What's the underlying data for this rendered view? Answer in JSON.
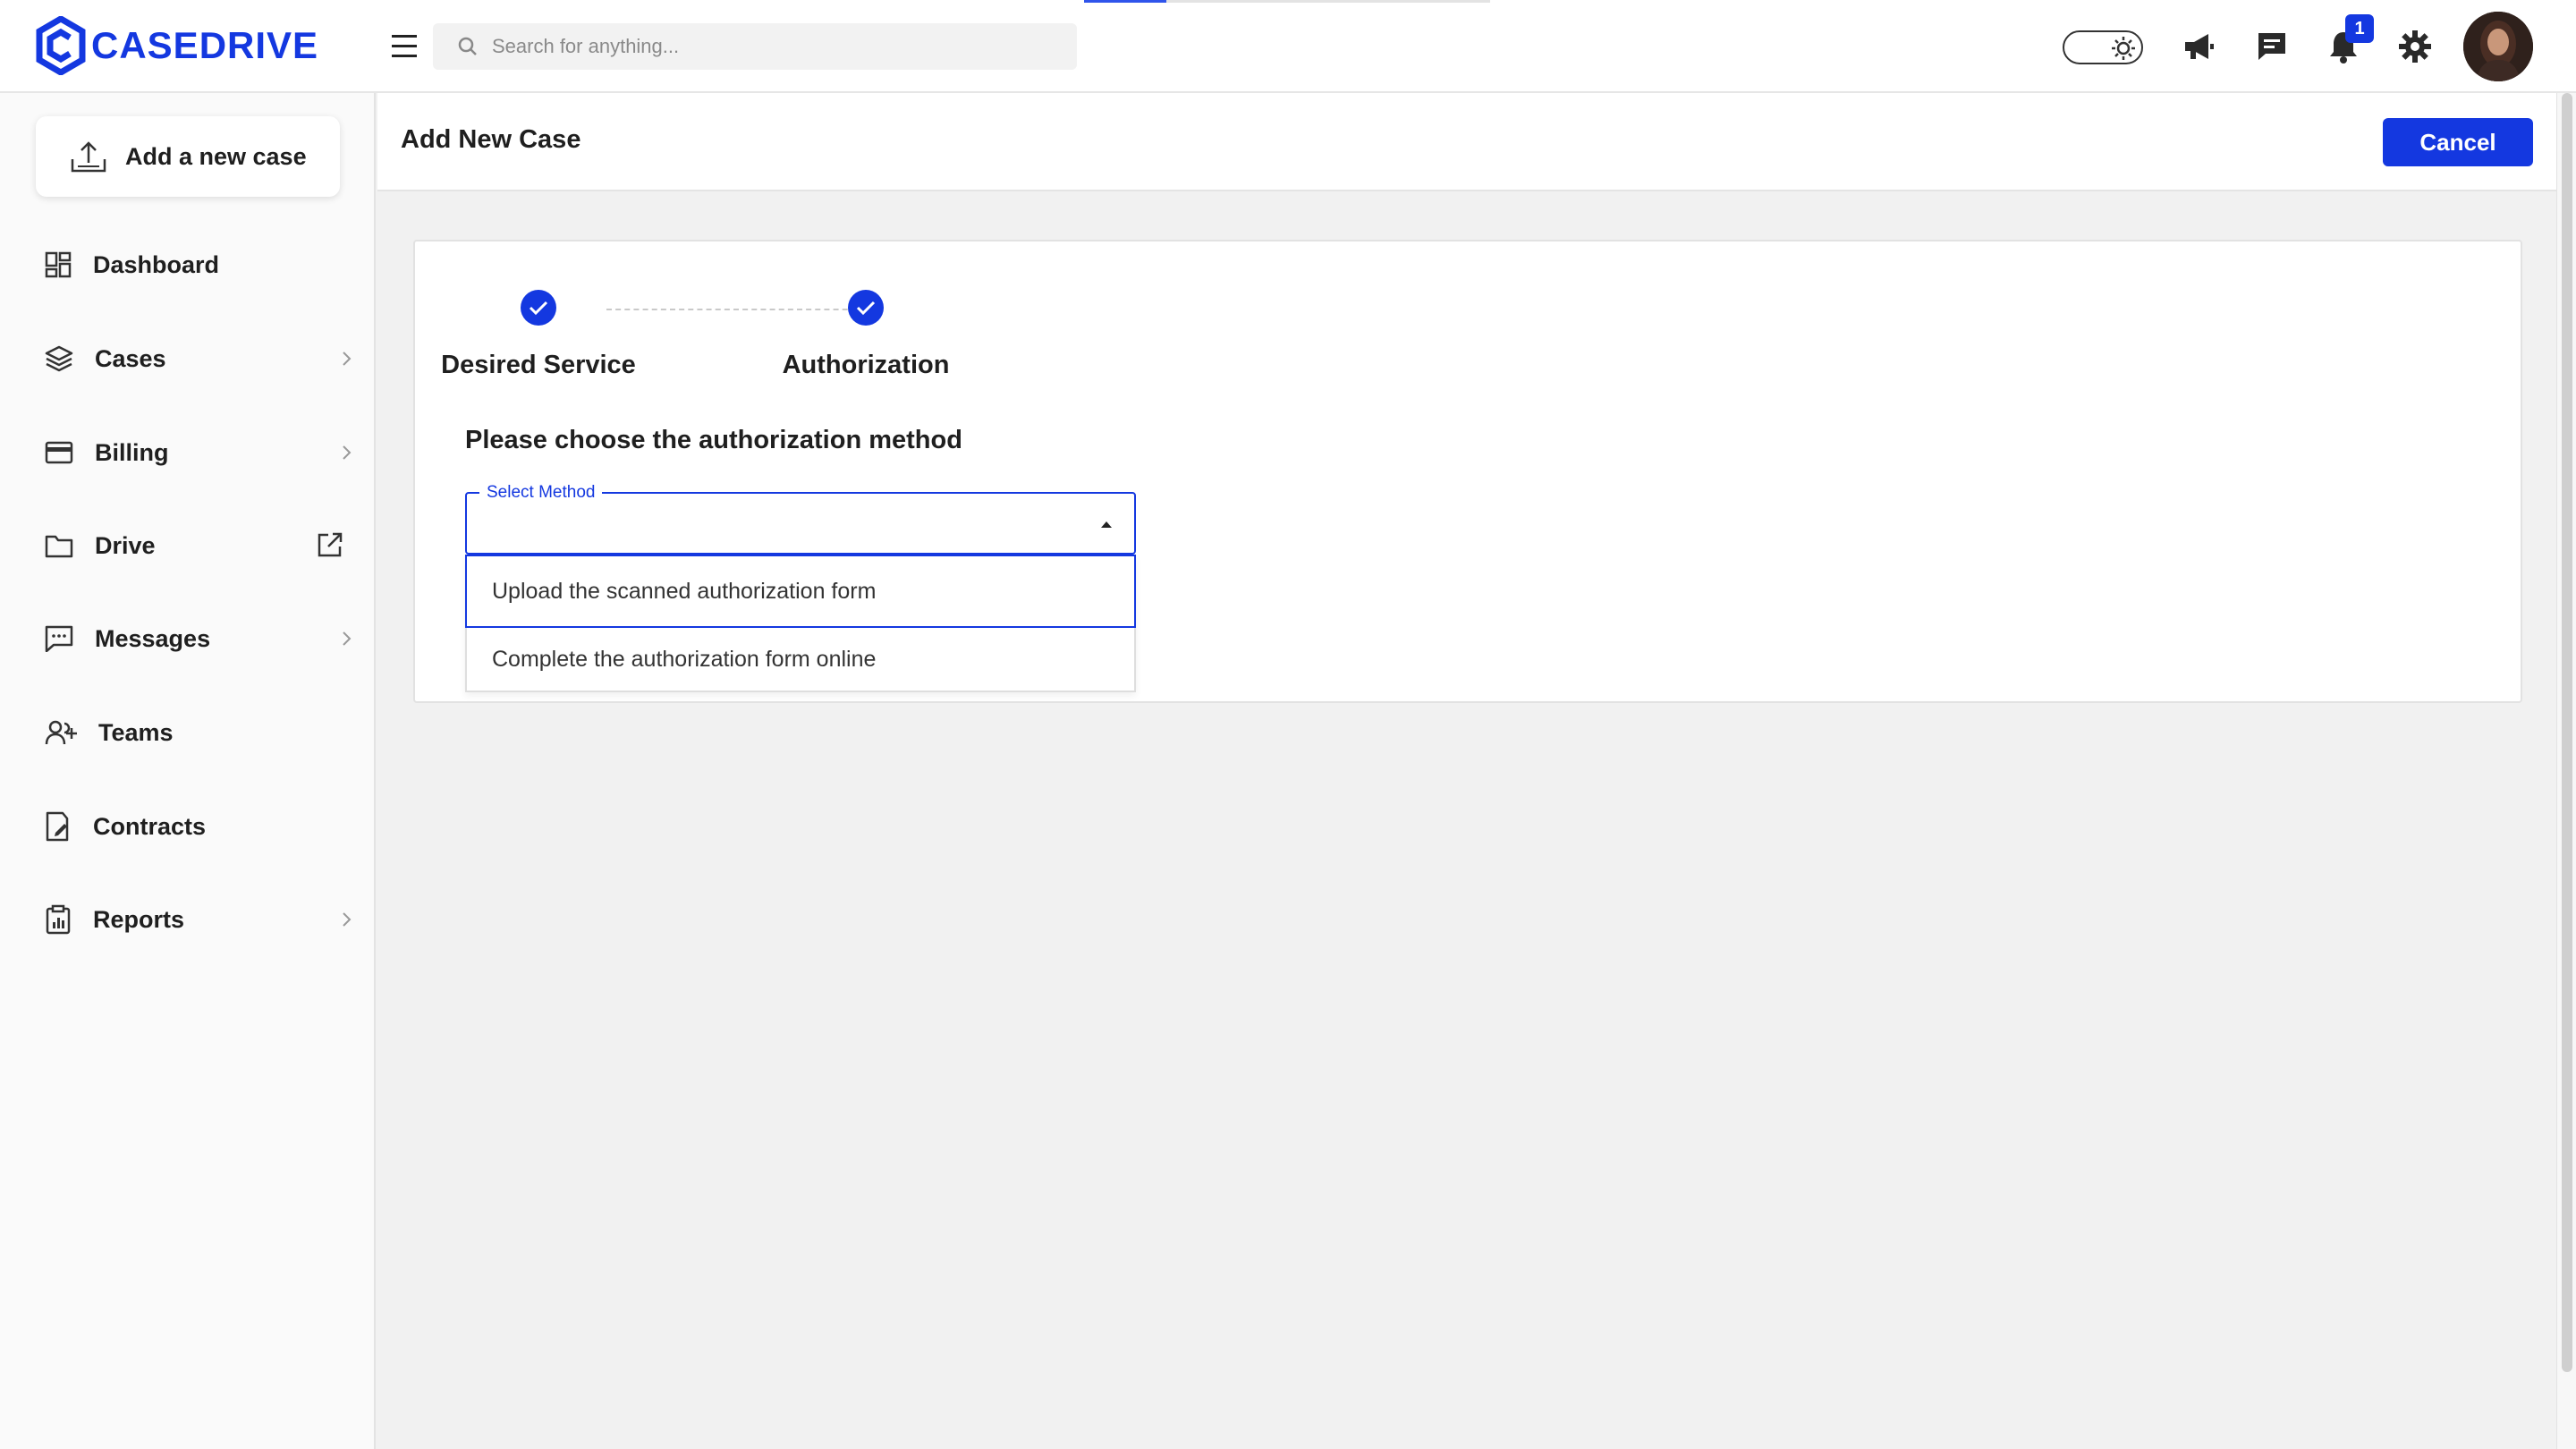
{
  "app": {
    "logo_text": "CASEDRIVE",
    "brand_color": "#1438e0"
  },
  "topbar": {
    "search_placeholder": "Search for anything...",
    "notification_count": "1",
    "icons": [
      "menu-icon",
      "search-icon",
      "theme-toggle",
      "megaphone-icon",
      "chat-icon",
      "bell-icon",
      "gear-icon",
      "avatar"
    ]
  },
  "sidebar": {
    "add_case_label": "Add a new case",
    "items": [
      {
        "label": "Dashboard",
        "icon": "dashboard-icon",
        "trailing": "none"
      },
      {
        "label": "Cases",
        "icon": "layers-icon",
        "trailing": "chevron"
      },
      {
        "label": "Billing",
        "icon": "card-icon",
        "trailing": "chevron"
      },
      {
        "label": "Drive",
        "icon": "folder-icon",
        "trailing": "external"
      },
      {
        "label": "Messages",
        "icon": "message-icon",
        "trailing": "chevron"
      },
      {
        "label": "Teams",
        "icon": "team-icon",
        "trailing": "none"
      },
      {
        "label": "Contracts",
        "icon": "contract-icon",
        "trailing": "none"
      },
      {
        "label": "Reports",
        "icon": "clipboard-icon",
        "trailing": "chevron"
      }
    ]
  },
  "header": {
    "title": "Add New Case",
    "cancel_label": "Cancel"
  },
  "wizard": {
    "steps": [
      {
        "label": "Desired Service",
        "status": "complete"
      },
      {
        "label": "Authorization",
        "status": "complete"
      }
    ],
    "question": "Please choose the authorization method",
    "select": {
      "legend": "Select Method",
      "value": "",
      "options": [
        "Upload the scanned authorization form",
        "Complete the authorization form online"
      ]
    }
  }
}
